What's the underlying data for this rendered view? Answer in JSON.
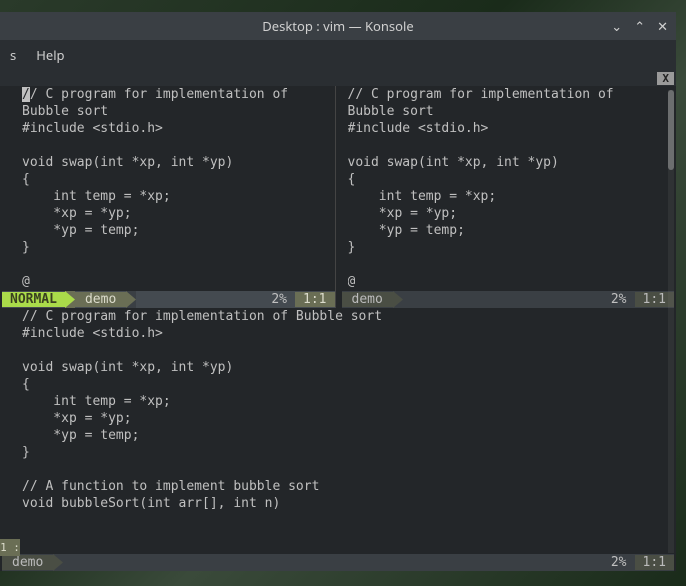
{
  "window": {
    "title": "Desktop : vim — Konsole",
    "controls": {
      "min": "⌄",
      "max": "⌃",
      "close": "✕"
    }
  },
  "menubar": {
    "item0": "s",
    "item1": "Help"
  },
  "tabbar": {
    "close": "X"
  },
  "code": {
    "topLeft": "// C program for implementation of\nBubble sort\n#include <stdio.h>\n\nvoid swap(int *xp, int *yp)\n{\n    int temp = *xp;\n    *xp = *yp;\n    *yp = temp;\n}\n\n@",
    "topRight": "// C program for implementation of\nBubble sort\n#include <stdio.h>\n\nvoid swap(int *xp, int *yp)\n{\n    int temp = *xp;\n    *xp = *yp;\n    *yp = temp;\n}\n\n@",
    "bottom": "// C program for implementation of Bubble sort\n#include <stdio.h>\n\nvoid swap(int *xp, int *yp)\n{\n    int temp = *xp;\n    *xp = *yp;\n    *yp = temp;\n}\n\n// A function to implement bubble sort\nvoid bubbleSort(int arr[], int n)"
  },
  "status": {
    "active": {
      "mode": "NORMAL",
      "file": "demo",
      "pct": "2%",
      "pos": "1:1"
    },
    "inactive1": {
      "file": "demo",
      "pct": "2%",
      "pos": "1:1"
    },
    "inactive2": {
      "file": "demo",
      "pct": "2%",
      "pos": "1:1"
    },
    "leftmark": "1 :"
  }
}
